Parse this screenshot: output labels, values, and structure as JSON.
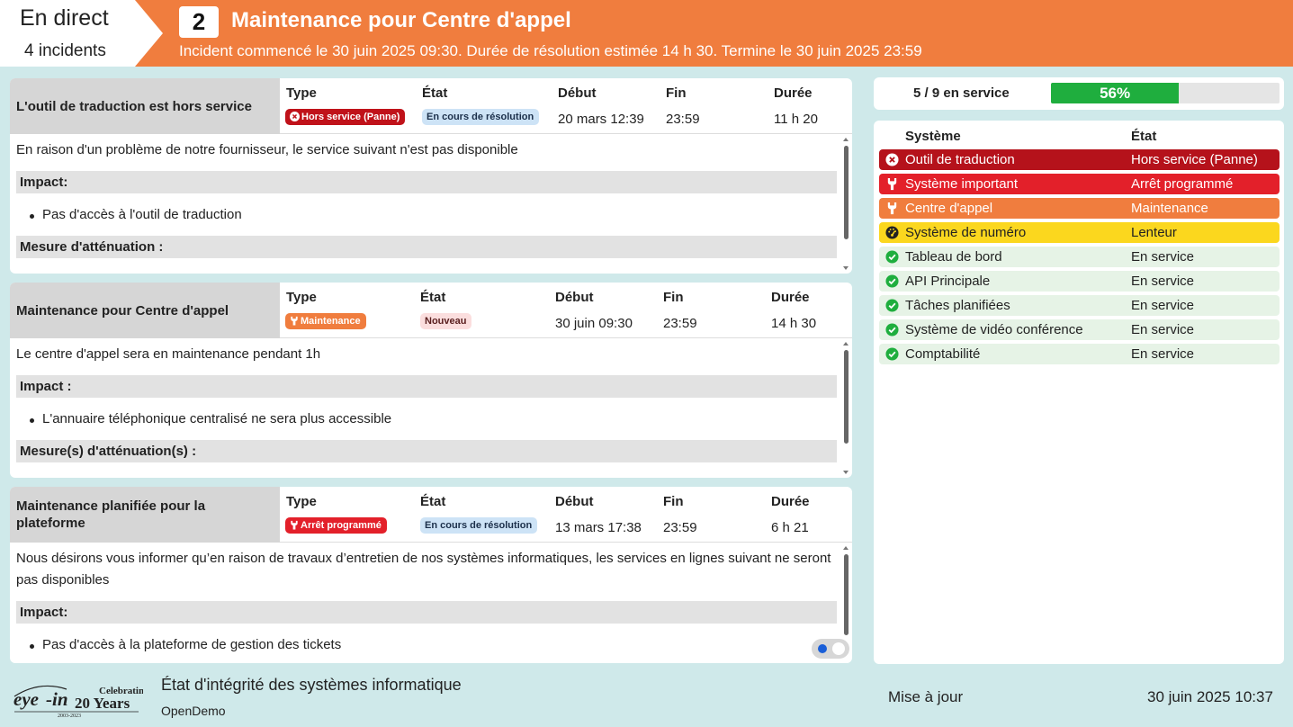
{
  "header": {
    "live_title": "En direct",
    "live_count": "4 incidents",
    "number": "2",
    "title": "Maintenance pour Centre d'appel",
    "subtitle": "Incident commencé le 30 juin 2025 09:30. Durée de résolution estimée 14 h 30. Termine le 30 juin 2025 23:59",
    "color": "#f07d3e"
  },
  "columns": {
    "type": "Type",
    "state": "État",
    "start": "Début",
    "end": "Fin",
    "duration": "Durée"
  },
  "incidents": [
    {
      "name": "L'outil de traduction est hors service",
      "type": "Hors service (Panne)",
      "type_icon": "x-circle-icon",
      "state": "En cours de résolution",
      "start": "20 mars 12:39",
      "end": "23:59",
      "duration": "11 h 20",
      "description": "En raison d'un problème de notre fournisseur, le service suivant n'est pas disponible",
      "impact_label": "Impact:",
      "impacts": [
        "Pas d'accès à l'outil de traduction"
      ],
      "mitigation_label": "Mesure d'atténuation :"
    },
    {
      "name": "Maintenance pour Centre d'appel",
      "type": "Maintenance",
      "type_icon": "wrench-icon",
      "state": "Nouveau",
      "start": "30 juin 09:30",
      "end": "23:59",
      "duration": "14 h 30",
      "description": "Le centre d'appel sera en maintenance pendant 1h",
      "impact_label": "Impact :",
      "impacts": [
        "L'annuaire téléphonique centralisé ne sera plus accessible"
      ],
      "mitigation_label": "Mesure(s) d'atténuation(s) :"
    },
    {
      "name": "Maintenance planifiée pour la plateforme",
      "type": "Arrêt programmé",
      "type_icon": "wrench-icon",
      "state": "En cours de résolution",
      "start": "13 mars 17:38",
      "end": "23:59",
      "duration": "6 h 21",
      "description": "Nous désirons vous informer qu’en raison de travaux d’entretien de nos systèmes informatiques, les services en lignes suivant ne seront pas disponibles",
      "impact_label": "Impact:",
      "impacts": [
        "Pas d'accès à la plateforme de gestion des tickets"
      ]
    }
  ],
  "summary": {
    "text": "5 / 9 en service",
    "percent_label": "56%",
    "fraction": 0.56,
    "bar_color": "#1fae3e"
  },
  "systems": {
    "header_system": "Système",
    "header_state": "État",
    "rows": [
      {
        "name": "Outil de traduction",
        "state": "Hors service (Panne)",
        "icon": "x-circle-icon",
        "bg": "#b5121b",
        "fg": "#ffffff"
      },
      {
        "name": "Système important",
        "state": "Arrêt programmé",
        "icon": "wrench-icon",
        "bg": "#e3202a",
        "fg": "#ffffff"
      },
      {
        "name": "Centre d'appel",
        "state": "Maintenance",
        "icon": "wrench-icon",
        "bg": "#f07d3e",
        "fg": "#ffffff"
      },
      {
        "name": "Système de numéro",
        "state": "Lenteur",
        "icon": "gauge-icon",
        "bg": "#fbd71e",
        "fg": "#222222"
      },
      {
        "name": "Tableau de bord",
        "state": "En service",
        "icon": "check-circle-icon",
        "bg": "#e6f3e6",
        "fg": "#222222"
      },
      {
        "name": "API Principale",
        "state": "En service",
        "icon": "check-circle-icon",
        "bg": "#e6f3e6",
        "fg": "#222222"
      },
      {
        "name": "Tâches planifiées",
        "state": "En service",
        "icon": "check-circle-icon",
        "bg": "#e6f3e6",
        "fg": "#222222"
      },
      {
        "name": "Système de vidéo conférence",
        "state": "En service",
        "icon": "check-circle-icon",
        "bg": "#e6f3e6",
        "fg": "#222222"
      },
      {
        "name": "Comptabilité",
        "state": "En service",
        "icon": "check-circle-icon",
        "bg": "#e6f3e6",
        "fg": "#222222"
      }
    ]
  },
  "footer": {
    "logo_text": "eye-in",
    "logo_celebrating": "Celebrating",
    "logo_years": "20 Years",
    "logo_range": "2003-2023",
    "title": "État d'intégrité des systèmes informatique",
    "subtitle": "OpenDemo",
    "update_label": "Mise à jour",
    "update_date": "30 juin 2025 10:37"
  }
}
